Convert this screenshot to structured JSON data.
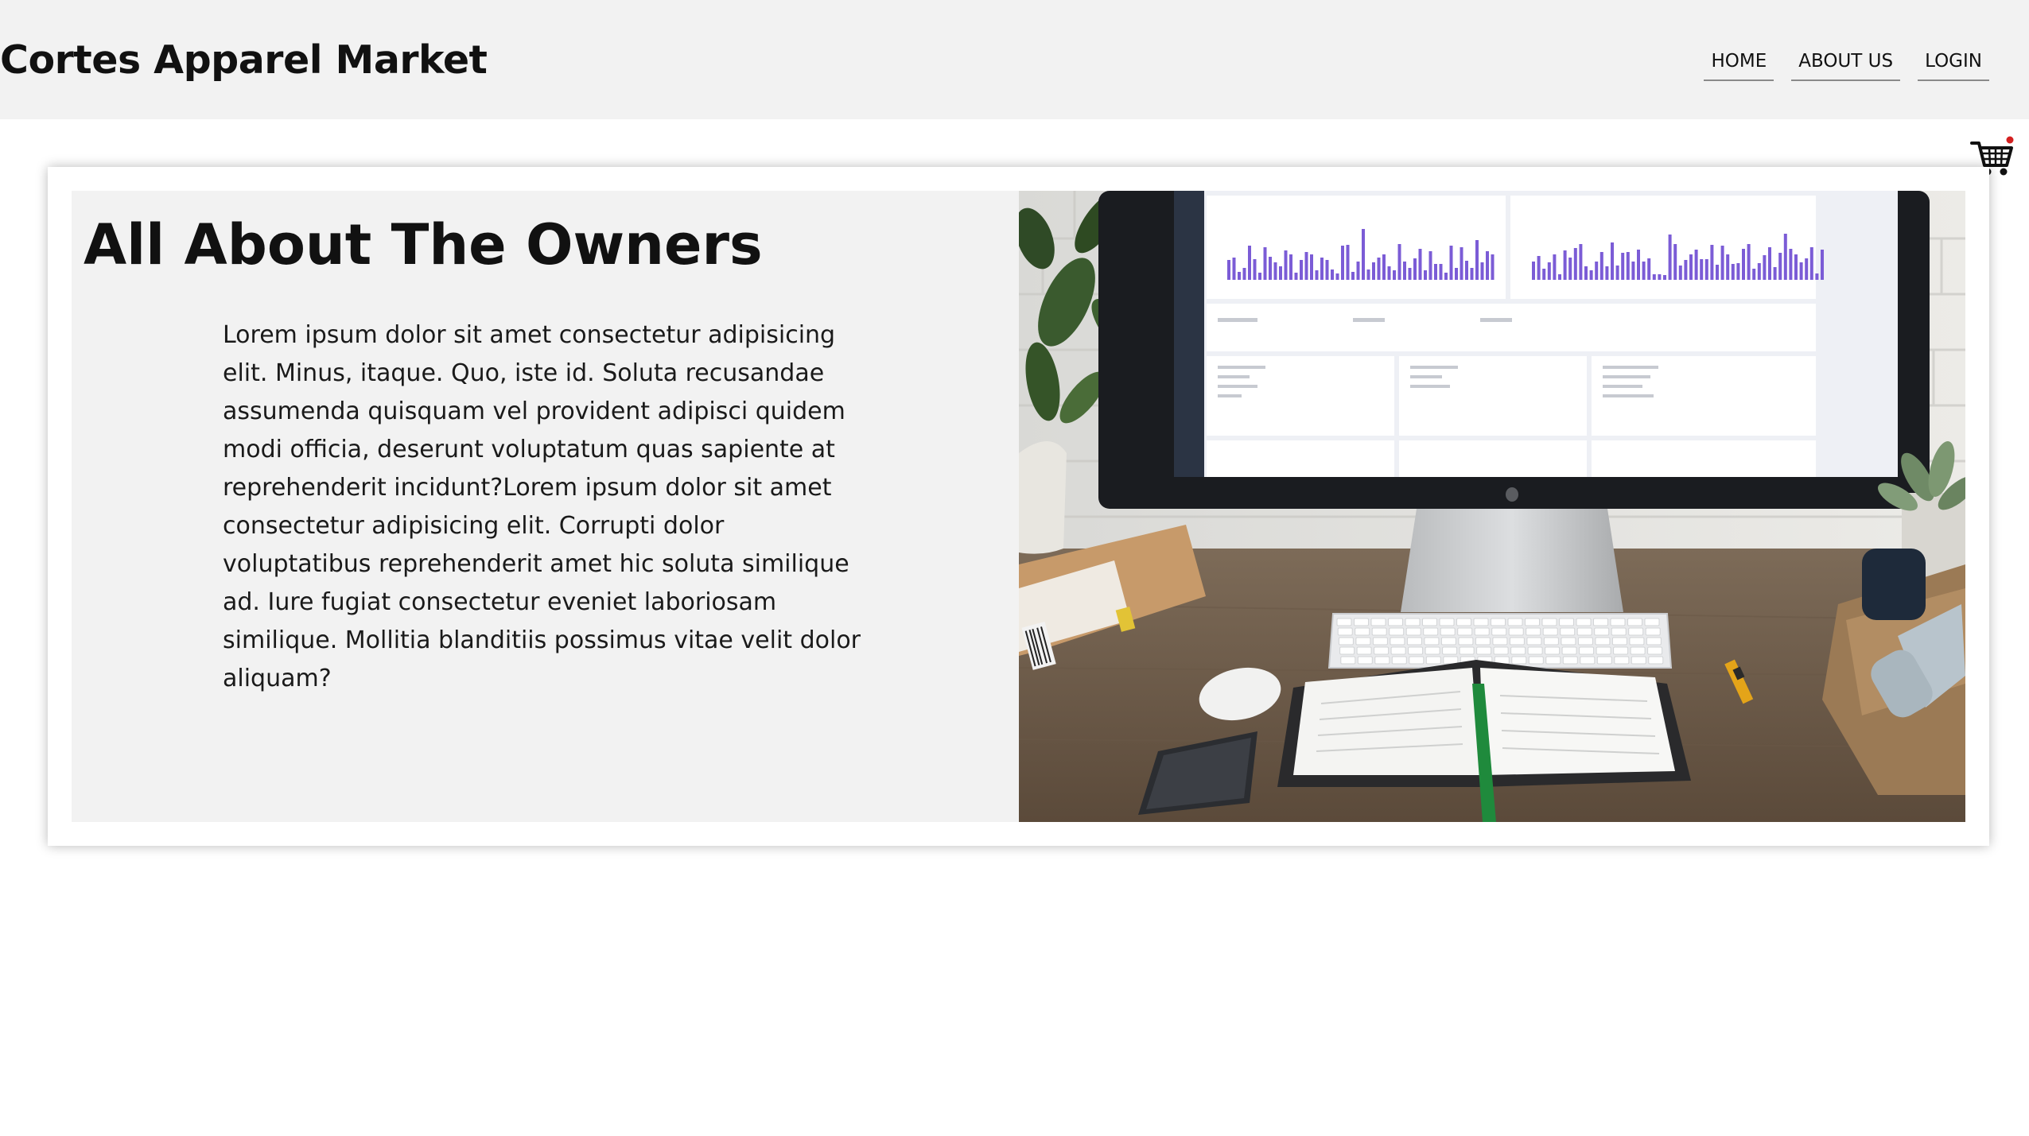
{
  "header": {
    "brand": "Cortes Apparel Market",
    "nav": [
      {
        "label": "HOME"
      },
      {
        "label": "ABOUT US"
      },
      {
        "label": "LOGIN"
      }
    ]
  },
  "icons": {
    "cart": "shopping-cart-icon"
  },
  "about": {
    "heading": "All About The Owners",
    "body": "Lorem ipsum dolor sit amet consectetur adipisicing elit. Minus, itaque. Quo, iste id. Soluta recusandae assumenda quisquam vel provident adipisci quidem modi officia, deserunt voluptatum quas sapiente at reprehenderit incidunt?Lorem ipsum dolor sit amet consectetur adipisicing elit. Corrupti dolor voluptatibus reprehenderit amet hic soluta similique ad. Iure fugiat consectetur eveniet laboriosam similique. Mollitia blanditiis possimus vitae velit dolor aliquam?",
    "image_alt": "desk-photo"
  },
  "colors": {
    "header_bg": "#f2f2f2",
    "panel_bg": "#f2f2f2",
    "page_bg": "#ffffff",
    "chart_bars": "#7b5cd6"
  }
}
